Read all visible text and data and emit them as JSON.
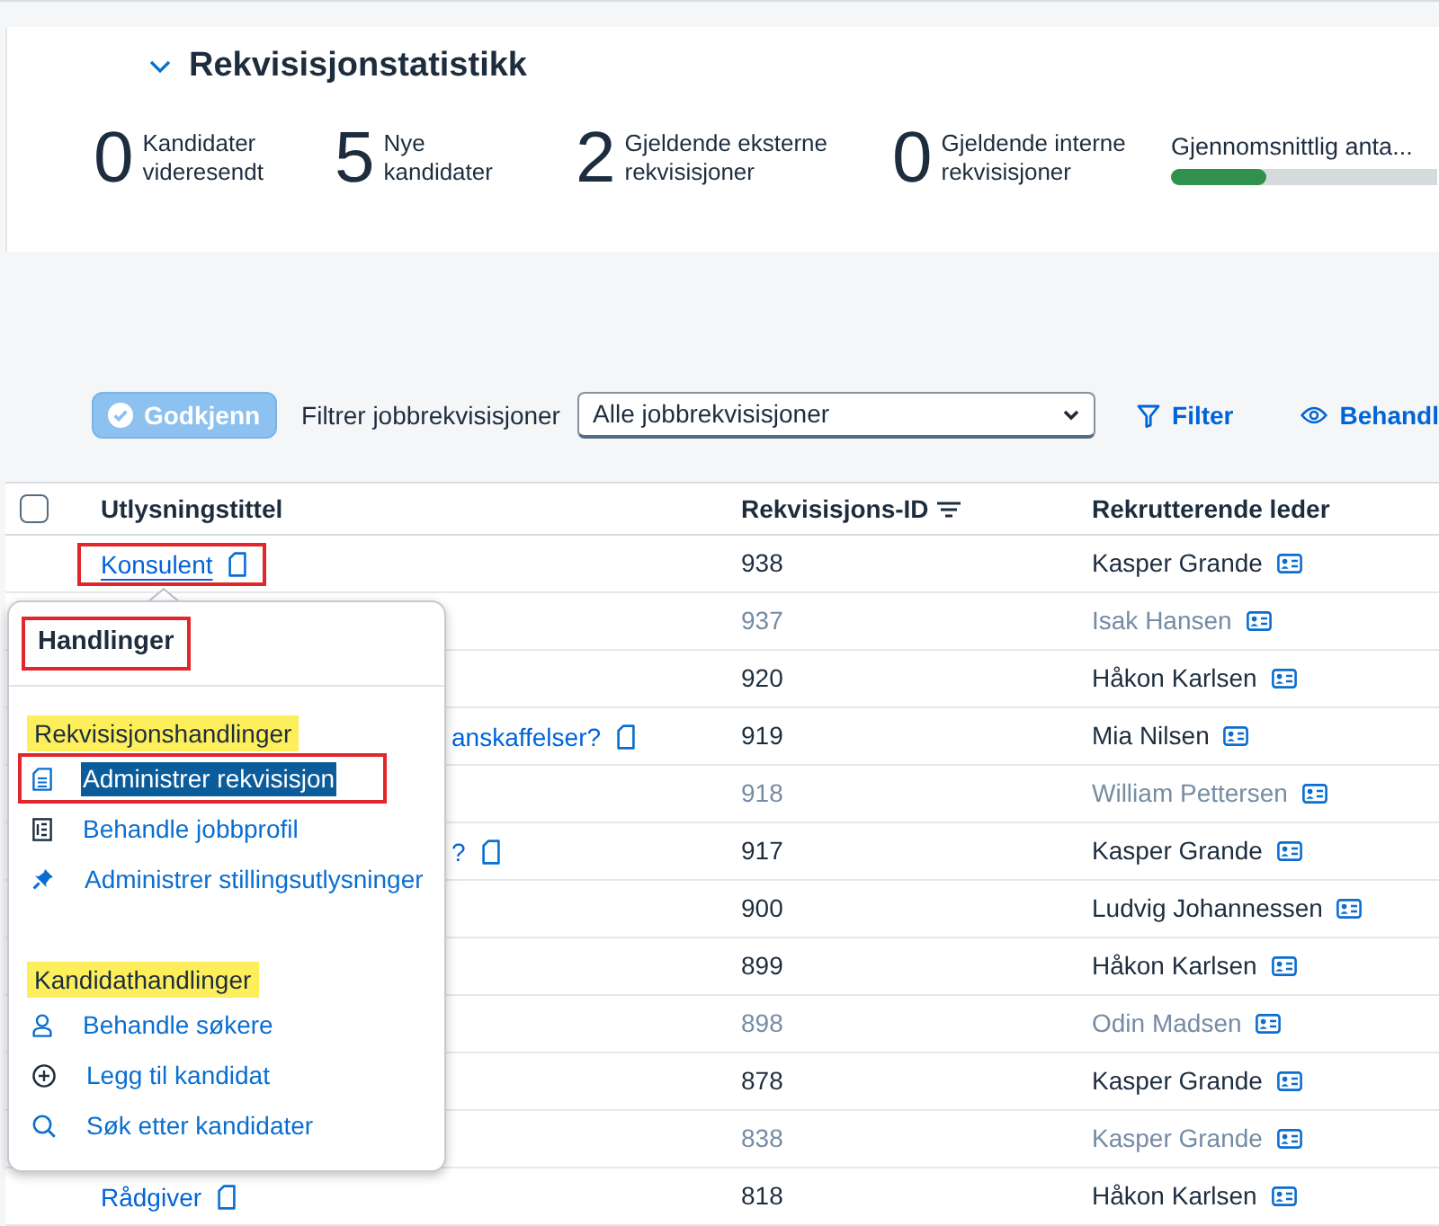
{
  "section": {
    "title": "Rekvisisjonstatistikk",
    "expanded": true
  },
  "stats": [
    {
      "kind": "count",
      "value": "0",
      "label": "Kandidater videresendt"
    },
    {
      "kind": "count",
      "value": "5",
      "label": "Nye kandidater"
    },
    {
      "kind": "count",
      "value": "2",
      "label": "Gjeldende eksterne rekvisisjoner"
    },
    {
      "kind": "count",
      "value": "0",
      "label": "Gjeldende interne rekvisisjoner"
    },
    {
      "kind": "meter",
      "label": "Gjennomsnittlig anta...",
      "level": 0.36
    }
  ],
  "toolbar": {
    "approve_button": {
      "label": "Godkjenn",
      "disabled": true
    },
    "filter_label": "Filtrer jobbrekvisisjoner",
    "filter_select": {
      "value": "Alle jobbrekvisisjoner"
    },
    "buttons": [
      {
        "kind": "filter",
        "label": "Filter"
      },
      {
        "kind": "view",
        "label": "Behandl"
      }
    ]
  },
  "table": {
    "select_all": {
      "checked": false
    },
    "columns": [
      {
        "label": "Utlysningstittel",
        "sorted": false
      },
      {
        "label": "Rekvisisjons-ID",
        "sorted": true
      },
      {
        "label": "Rekrutterende leder",
        "sorted": false
      }
    ],
    "rows": [
      {
        "title": {
          "text": "Konsulent",
          "hovered": true,
          "annotated": true,
          "covered": false
        },
        "id": "938",
        "leader": "Kasper Grande",
        "disabled": false
      },
      {
        "id": "937",
        "leader": "Isak Hansen",
        "disabled": true
      },
      {
        "id": "920",
        "leader": "Håkon Karlsen",
        "disabled": false
      },
      {
        "title": {
          "text": "anskaffelser?",
          "hovered": false,
          "annotated": false,
          "covered": true
        },
        "id": "919",
        "leader": "Mia Nilsen",
        "disabled": false
      },
      {
        "id": "918",
        "leader": "William Pettersen",
        "disabled": true
      },
      {
        "title": {
          "text": "?",
          "hovered": false,
          "annotated": false,
          "covered": true
        },
        "id": "917",
        "leader": "Kasper Grande",
        "disabled": false
      },
      {
        "id": "900",
        "leader": "Ludvig Johannessen",
        "disabled": false
      },
      {
        "id": "899",
        "leader": "Håkon Karlsen",
        "disabled": false
      },
      {
        "id": "898",
        "leader": "Odin Madsen",
        "disabled": true
      },
      {
        "id": "878",
        "leader": "Kasper Grande",
        "disabled": false
      },
      {
        "id": "838",
        "leader": "Kasper Grande",
        "disabled": true
      },
      {
        "title": {
          "text": "Rådgiver",
          "hovered": false,
          "annotated": false,
          "covered": false
        },
        "id": "818",
        "leader": "Håkon Karlsen",
        "disabled": false
      }
    ]
  },
  "popover": {
    "title": {
      "text": "Handlinger",
      "annotated": true
    },
    "groups": [
      {
        "heading": "Rekvisisjonshandlinger",
        "highlighted": true,
        "items": [
          {
            "kind": "requisition",
            "label": "Administrer rekvisisjon",
            "selected": true,
            "annotated": true
          },
          {
            "kind": "job_profile",
            "label": "Behandle jobbprofil",
            "selected": false,
            "annotated": false
          },
          {
            "kind": "postings",
            "label": "Administrer stillingsutlysninger",
            "selected": false,
            "annotated": false
          }
        ]
      },
      {
        "heading": "Kandidathandlinger",
        "highlighted": true,
        "items": [
          {
            "kind": "applicants",
            "label": "Behandle søkere",
            "selected": false,
            "annotated": false
          },
          {
            "kind": "add_candidate",
            "label": "Legg til kandidat",
            "selected": false,
            "annotated": false
          },
          {
            "kind": "search",
            "label": "Søk etter kandidater",
            "selected": false,
            "annotated": false
          }
        ]
      }
    ]
  }
}
